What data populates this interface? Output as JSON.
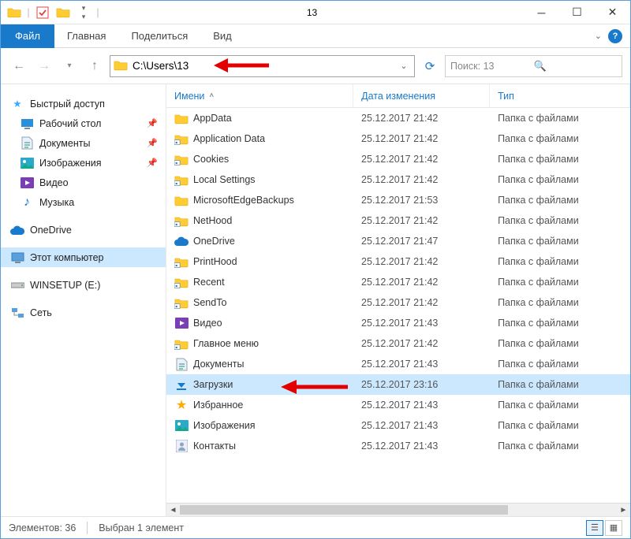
{
  "title": "13",
  "ribbon": {
    "file": "Файл",
    "tabs": [
      "Главная",
      "Поделиться",
      "Вид"
    ]
  },
  "address": "C:\\Users\\13",
  "search_placeholder": "Поиск: 13",
  "columns": {
    "name": "Имени",
    "date": "Дата изменения",
    "type": "Тип"
  },
  "sidebar": {
    "quick": "Быстрый доступ",
    "quick_items": [
      {
        "label": "Рабочий стол",
        "pinned": true,
        "icon": "desktop"
      },
      {
        "label": "Документы",
        "pinned": true,
        "icon": "doc"
      },
      {
        "label": "Изображения",
        "pinned": true,
        "icon": "pic"
      },
      {
        "label": "Видео",
        "pinned": false,
        "icon": "video"
      },
      {
        "label": "Музыка",
        "pinned": false,
        "icon": "music"
      }
    ],
    "onedrive": "OneDrive",
    "thispc": "Этот компьютер",
    "drive": "WINSETUP (E:)",
    "network": "Сеть"
  },
  "files": [
    {
      "name": "AppData",
      "date": "25.12.2017 21:42",
      "type": "Папка с файлами",
      "icon": "folder"
    },
    {
      "name": "Application Data",
      "date": "25.12.2017 21:42",
      "type": "Папка с файлами",
      "icon": "folder-sc"
    },
    {
      "name": "Cookies",
      "date": "25.12.2017 21:42",
      "type": "Папка с файлами",
      "icon": "folder-sc"
    },
    {
      "name": "Local Settings",
      "date": "25.12.2017 21:42",
      "type": "Папка с файлами",
      "icon": "folder-sc"
    },
    {
      "name": "MicrosoftEdgeBackups",
      "date": "25.12.2017 21:53",
      "type": "Папка с файлами",
      "icon": "folder"
    },
    {
      "name": "NetHood",
      "date": "25.12.2017 21:42",
      "type": "Папка с файлами",
      "icon": "folder-sc"
    },
    {
      "name": "OneDrive",
      "date": "25.12.2017 21:47",
      "type": "Папка с файлами",
      "icon": "onedrive"
    },
    {
      "name": "PrintHood",
      "date": "25.12.2017 21:42",
      "type": "Папка с файлами",
      "icon": "folder-sc"
    },
    {
      "name": "Recent",
      "date": "25.12.2017 21:42",
      "type": "Папка с файлами",
      "icon": "folder-sc"
    },
    {
      "name": "SendTo",
      "date": "25.12.2017 21:42",
      "type": "Папка с файлами",
      "icon": "folder-sc"
    },
    {
      "name": "Видео",
      "date": "25.12.2017 21:43",
      "type": "Папка с файлами",
      "icon": "video"
    },
    {
      "name": "Главное меню",
      "date": "25.12.2017 21:42",
      "type": "Папка с файлами",
      "icon": "folder-sc"
    },
    {
      "name": "Документы",
      "date": "25.12.2017 21:43",
      "type": "Папка с файлами",
      "icon": "doc"
    },
    {
      "name": "Загрузки",
      "date": "25.12.2017 23:16",
      "type": "Папка с файлами",
      "icon": "download",
      "selected": true
    },
    {
      "name": "Избранное",
      "date": "25.12.2017 21:43",
      "type": "Папка с файлами",
      "icon": "star"
    },
    {
      "name": "Изображения",
      "date": "25.12.2017 21:43",
      "type": "Папка с файлами",
      "icon": "pic"
    },
    {
      "name": "Контакты",
      "date": "25.12.2017 21:43",
      "type": "Папка с файлами",
      "icon": "contact"
    }
  ],
  "status": {
    "count": "Элементов: 36",
    "selected": "Выбран 1 элемент"
  }
}
